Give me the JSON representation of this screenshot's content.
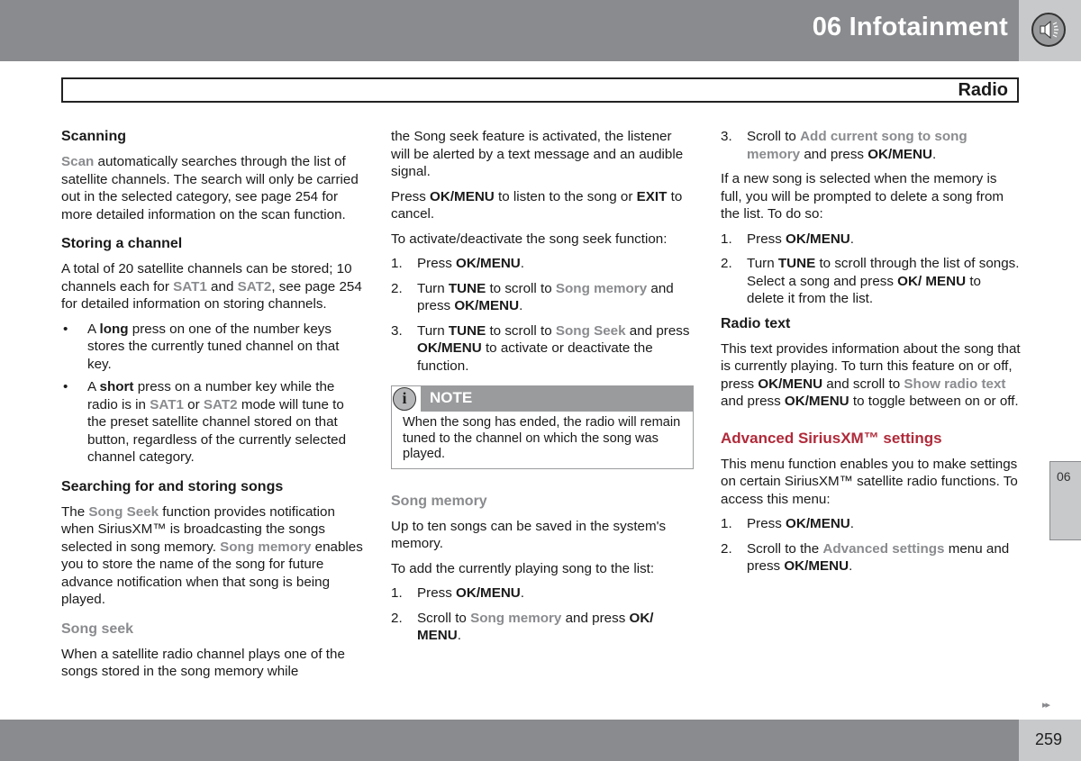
{
  "header": {
    "chapter_title": "06 Infotainment",
    "chapter_icon": "speaker-icon",
    "section_title": "Radio"
  },
  "colors": {
    "header_grey": "#8a8b8e",
    "tab_light_grey": "#c8c9cb",
    "highlight_grey": "#8a8b8e",
    "accent_red": "#b02a3a"
  },
  "col1": {
    "scanning": {
      "heading": "Scanning",
      "p1_link": "Scan",
      "p1_text": " automatically searches through the list of satellite channels. The search will only be carried out in the selected category, see page 254 for more detailed information on the scan function."
    },
    "storing": {
      "heading": "Storing a channel",
      "p1_a": "A total of 20 satellite channels can be stored; 10 channels each for ",
      "p1_sat1": "SAT1",
      "p1_b": " and ",
      "p1_sat2": "SAT2",
      "p1_c": ", see page 254 for detailed information on storing channels.",
      "bullet_glyph": "•",
      "bullet1_a": "A ",
      "bullet1_bold": "long",
      "bullet1_b": " press on one of the number keys stores the currently tuned channel on that key.",
      "bullet2_a": "A ",
      "bullet2_bold": "short",
      "bullet2_b": " press on a number key while the radio is in ",
      "bullet2_sat1": "SAT1",
      "bullet2_c": " or ",
      "bullet2_sat2": "SAT2",
      "bullet2_d": " mode will tune to the preset satellite channel stored on that button, regardless of the currently selected channel category."
    },
    "searching": {
      "heading": "Searching for and storing songs",
      "p1_a": "The ",
      "p1_link1": "Song Seek",
      "p1_b": " function provides notification when SiriusXM™ is broadcasting the songs selected in song memory. ",
      "p1_link2": "Song memory",
      "p1_c": " enables you to store the name of the song for future advance notification when that song is being played."
    },
    "song_seek": {
      "heading": "Song seek",
      "p1": "When a satellite radio channel plays one of the songs stored in the song memory while"
    }
  },
  "col2": {
    "p_cont": "the Song seek feature is activated, the listener will be alerted by a text message and an audible signal.",
    "p_press_a": "Press ",
    "p_press_ok": "OK/MENU",
    "p_press_b": " to listen to the song or ",
    "p_press_exit": "EXIT",
    "p_press_c": " to cancel.",
    "p_activate": "To activate/deactivate the song seek function:",
    "steps": {
      "s1_num": "1.",
      "s1_a": "Press ",
      "s1_bold": "OK/MENU",
      "s1_b": ".",
      "s2_num": "2.",
      "s2_a": "Turn ",
      "s2_tune": "TUNE",
      "s2_b": " to scroll to ",
      "s2_link": "Song memory",
      "s2_c": " and press ",
      "s2_ok": "OK/MENU",
      "s2_d": ".",
      "s3_num": "3.",
      "s3_a": "Turn ",
      "s3_tune": "TUNE",
      "s3_b": " to scroll to ",
      "s3_link": "Song Seek",
      "s3_c": " and press ",
      "s3_ok": "OK/MENU",
      "s3_d": " to activate or deactivate the function."
    },
    "note": {
      "icon": "info-icon",
      "icon_glyph": "i",
      "label": "NOTE",
      "body": "When the song has ended, the radio will remain tuned to the channel on which the song was played."
    },
    "song_memory": {
      "heading": "Song memory",
      "p1": "Up to ten songs can be saved in the system's memory.",
      "p2": "To add the currently playing song to the list:",
      "s1_num": "1.",
      "s1_a": "Press ",
      "s1_bold": "OK/MENU",
      "s1_b": ".",
      "s2_num": "2.",
      "s2_a": "Scroll to ",
      "s2_link": "Song memory",
      "s2_b": " and press ",
      "s2_ok": "OK/ MENU",
      "s2_c": "."
    }
  },
  "col3": {
    "s3_num": "3.",
    "s3_a": "Scroll to ",
    "s3_link": "Add current song to song memory",
    "s3_b": " and press ",
    "s3_ok": "OK/MENU",
    "s3_c": ".",
    "p_full": "If a new song is selected when the memory is full, you will be prompted to delete a song from the list. To do so:",
    "d1_num": "1.",
    "d1_a": "Press ",
    "d1_bold": "OK/MENU",
    "d1_b": ".",
    "d2_num": "2.",
    "d2_a": "Turn ",
    "d2_tune": "TUNE",
    "d2_b": " to scroll through the list of songs. Select a song and press ",
    "d2_ok": "OK/ MENU",
    "d2_c": " to delete it from the list.",
    "radio_text": {
      "heading": "Radio text",
      "p_a": "This text provides information about the song that is currently playing. To turn this feature on or off, press ",
      "p_ok1": "OK/MENU",
      "p_b": " and scroll to ",
      "p_link": "Show radio text",
      "p_c": " and press ",
      "p_ok2": "OK/MENU",
      "p_d": " to toggle between on or off."
    },
    "advanced": {
      "heading": "Advanced SiriusXM™ settings",
      "p1": "This menu function enables you to make settings on certain SiriusXM™ satellite radio functions. To access this menu:",
      "s1_num": "1.",
      "s1_a": "Press ",
      "s1_bold": "OK/MENU",
      "s1_b": ".",
      "s2_num": "2.",
      "s2_a": "Scroll to the ",
      "s2_link": "Advanced settings",
      "s2_b": " menu and press ",
      "s2_ok": "OK/MENU",
      "s2_c": "."
    }
  },
  "side_tab": {
    "label": "06"
  },
  "footer": {
    "next_glyph": "▸▸",
    "page_number": "259"
  }
}
